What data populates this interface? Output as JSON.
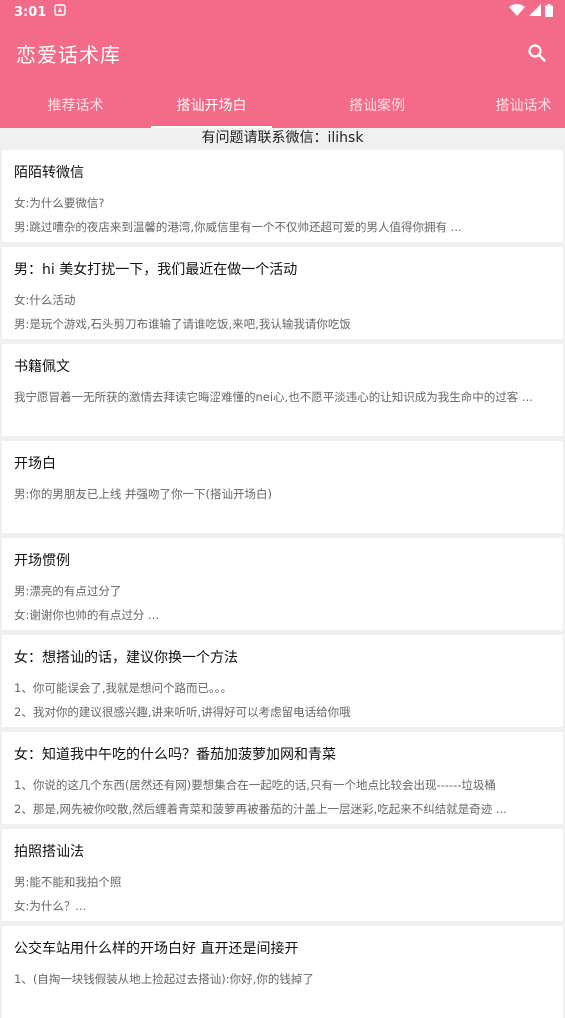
{
  "status": {
    "time": "3:01"
  },
  "app": {
    "title": "恋爱话术库"
  },
  "tabs": [
    {
      "label": "推荐话术"
    },
    {
      "label": "搭讪开场白"
    },
    {
      "label": "搭讪案例"
    },
    {
      "label": "搭讪话术"
    }
  ],
  "notice": "有问题请联系微信：ilihsk",
  "cards": [
    {
      "title": "陌陌转微信",
      "lines": [
        "女:为什么要微信?",
        "男:跳过嘈杂的夜店来到温馨的港湾,你威信里有一个不仅帅还超可爱的男人值得你拥有 ..."
      ]
    },
    {
      "title": "男：hi 美女打扰一下，我们最近在做一个活动",
      "lines": [
        "女:什么活动",
        "男:是玩个游戏,石头剪刀布谁输了请谁吃饭,来吧,我认输我请你吃饭"
      ]
    },
    {
      "title": "书籍佩文",
      "lines": [
        "我宁愿冒着一无所获的激情去拜读它晦涩难懂的nei心,也不愿平淡违心的让知识成为我生命中的过客 ..."
      ]
    },
    {
      "title": "开场白",
      "lines": [
        "男:你的男朋友已上线 并强吻了你一下(搭讪开场白)"
      ]
    },
    {
      "title": "开场惯例",
      "lines": [
        "男:漂亮的有点过分了",
        "女:谢谢你也帅的有点过分 ..."
      ]
    },
    {
      "title": "女：想搭讪的话，建议你换一个方法",
      "lines": [
        "1、你可能误会了,我就是想问个路而已。。。",
        "2、我对你的建议很感兴趣,讲来听听,讲得好可以考虑留电话给你哦"
      ]
    },
    {
      "title": "女：知道我中午吃的什么吗？番茄加菠萝加网和青菜",
      "lines": [
        "1、你说的这几个东西(居然还有网)要想集合在一起吃的话,只有一个地点比较会出现------垃圾桶",
        "2、那是,网先被你咬散,然后缠着青菜和菠萝再被番茄的汁盖上一层迷彩,吃起来不纠结就是奇迹 ..."
      ]
    },
    {
      "title": "拍照搭讪法",
      "lines": [
        "男:能不能和我拍个照",
        "女:为什么？..."
      ]
    },
    {
      "title": "公交车站用什么样的开场白好 直开还是间接开",
      "lines": [
        "1、(自掏一块钱假装从地上捡起过去搭讪):你好,你的钱掉了"
      ]
    }
  ]
}
